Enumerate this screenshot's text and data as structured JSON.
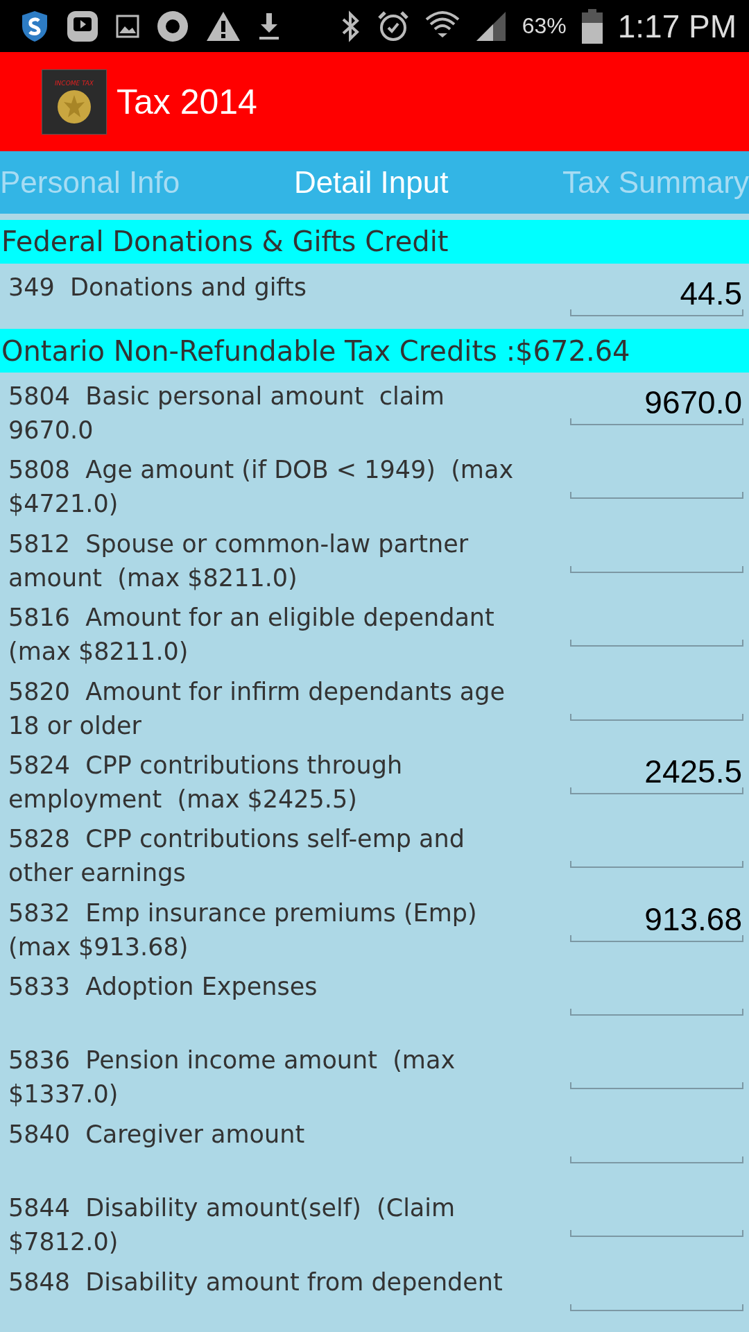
{
  "status_bar": {
    "battery": "63%",
    "time": "1:17 PM"
  },
  "app_bar": {
    "title": "Tax 2014",
    "logo_text": "INCOME TAX"
  },
  "tabs": [
    {
      "label": "Personal Info",
      "selected": false
    },
    {
      "label": "Detail Input",
      "selected": true
    },
    {
      "label": "Tax Summary",
      "selected": false
    }
  ],
  "sections": [
    {
      "title": "Federal Donations & Gifts Credit",
      "rows": [
        {
          "label": "349  Donations and gifts",
          "value": "44.5"
        }
      ]
    },
    {
      "title": "Ontario Non-Refundable Tax Credits :$672.64",
      "rows": [
        {
          "label": "5804  Basic personal amount  claim 9670.0",
          "value": "9670.0"
        },
        {
          "label": "5808  Age amount (if DOB < 1949)  (max $4721.0)"
        },
        {
          "label": "5812  Spouse or common-law partner amount  (max $8211.0)"
        },
        {
          "label": "5816  Amount for an eligible dependant (max $8211.0)"
        },
        {
          "label": "5820  Amount for infirm dependants age 18 or older"
        },
        {
          "label": "5824  CPP contributions through employment  (max $2425.5)",
          "value": "2425.5"
        },
        {
          "label": "5828  CPP contributions self-emp and other earnings"
        },
        {
          "label": "5832  Emp insurance premiums (Emp) (max $913.68)",
          "value": "913.68"
        },
        {
          "label": "5833  Adoption Expenses"
        },
        {
          "label": "5836  Pension income amount  (max $1337.0)"
        },
        {
          "label": "5840  Caregiver amount"
        },
        {
          "label": "5844  Disability amount(self)  (Claim $7812.0)"
        },
        {
          "label": "5848  Disability amount from dependent"
        }
      ]
    }
  ]
}
